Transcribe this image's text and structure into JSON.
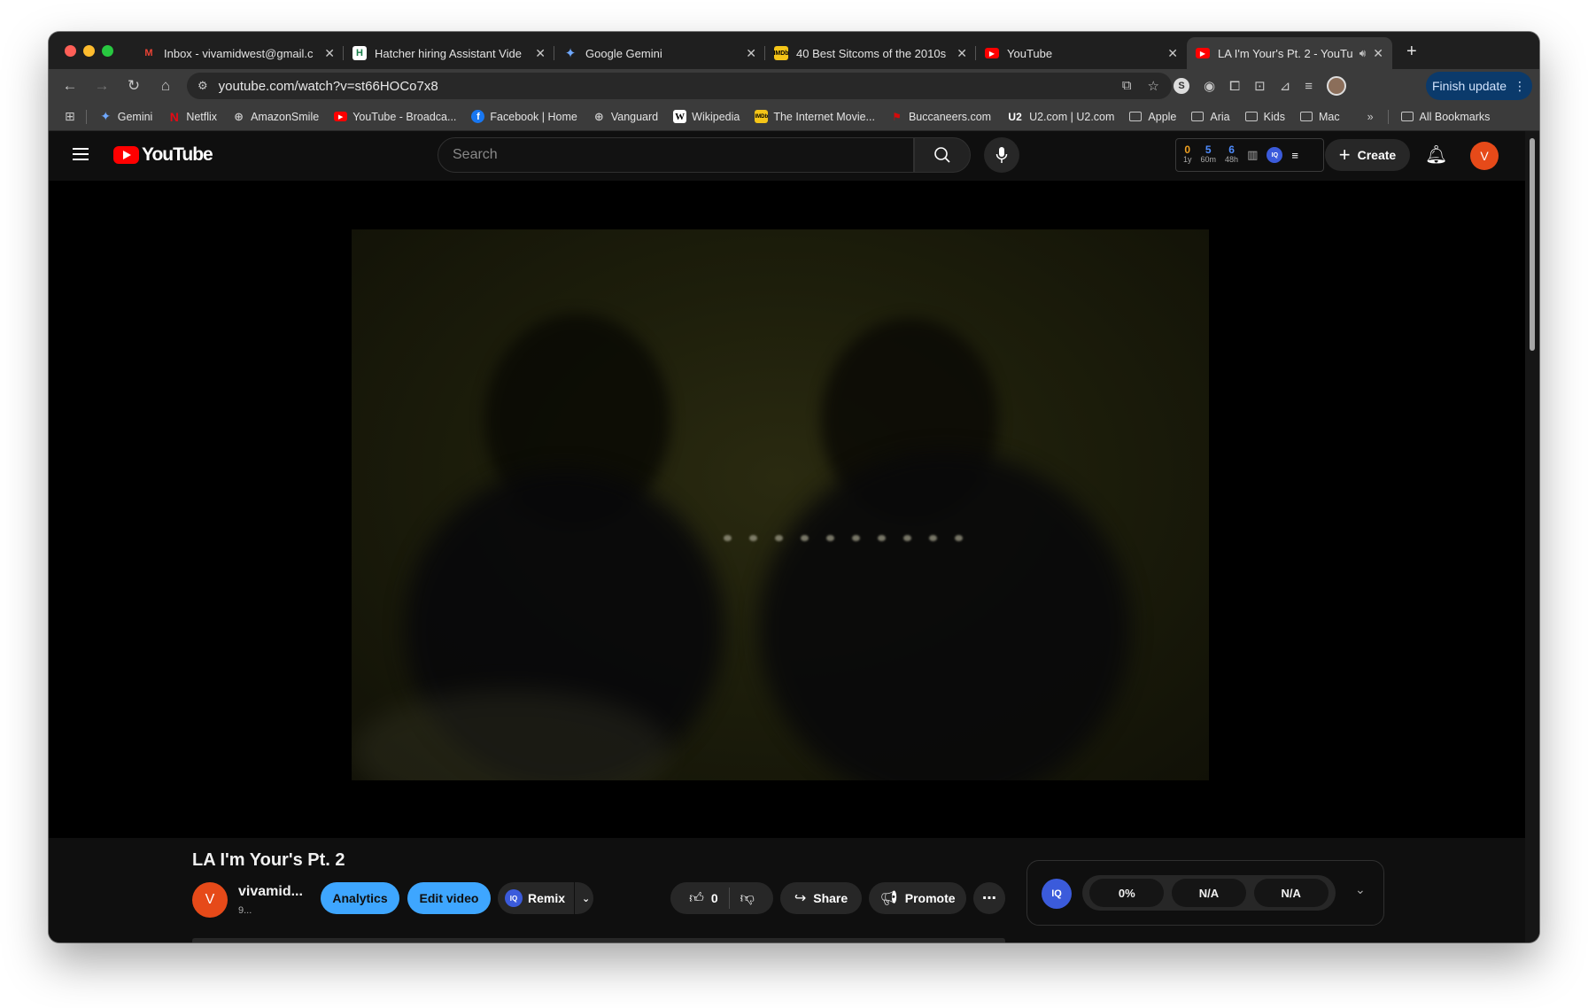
{
  "tabs": [
    {
      "label": "Inbox - vivamidwest@gmail.c",
      "icon": "gmail-icon",
      "active": false
    },
    {
      "label": "Hatcher hiring Assistant Vide",
      "icon": "hatcher-icon",
      "active": false
    },
    {
      "label": "Google Gemini",
      "icon": "gemini-icon",
      "active": false
    },
    {
      "label": "40 Best Sitcoms of the 2010s",
      "icon": "imdb-icon",
      "active": false
    },
    {
      "label": "YouTube",
      "icon": "youtube-icon",
      "active": false
    },
    {
      "label": "LA I'm Your's Pt. 2 - YouTu",
      "icon": "youtube-icon",
      "active": true
    }
  ],
  "toolbar": {
    "url": "youtube.com/watch?v=st66HOCo7x8",
    "finish_update": "Finish update"
  },
  "bookmarks": [
    {
      "label": "Gemini",
      "icon": "gemini-icon"
    },
    {
      "label": "Netflix",
      "icon": "netflix-icon"
    },
    {
      "label": "AmazonSmile",
      "icon": "globe-icon"
    },
    {
      "label": "YouTube - Broadca...",
      "icon": "youtube-icon"
    },
    {
      "label": "Facebook | Home",
      "icon": "facebook-icon"
    },
    {
      "label": "Vanguard",
      "icon": "globe-icon"
    },
    {
      "label": "Wikipedia",
      "icon": "wikipedia-icon"
    },
    {
      "label": "The Internet Movie...",
      "icon": "imdb-icon"
    },
    {
      "label": "Buccaneers.com",
      "icon": "buccaneers-icon"
    },
    {
      "label": "U2.com | U2.com",
      "icon": "u2-icon"
    },
    {
      "label": "Apple",
      "icon": "folder-icon"
    },
    {
      "label": "Aria",
      "icon": "folder-icon"
    },
    {
      "label": "Kids",
      "icon": "folder-icon"
    },
    {
      "label": "Mac",
      "icon": "folder-icon"
    }
  ],
  "all_bookmarks": "All Bookmarks",
  "yt": {
    "logo_text": "YouTube",
    "search_placeholder": "Search",
    "stats": [
      {
        "value": "0",
        "label": "1y",
        "color": "#f0a020"
      },
      {
        "value": "5",
        "label": "60m",
        "color": "#4e8cff"
      },
      {
        "value": "6",
        "label": "48h",
        "color": "#4e8cff"
      }
    ],
    "iq_label": "IQ",
    "create_label": "Create",
    "avatar_letter": "V"
  },
  "video": {
    "title": "LA I'm Your's Pt. 2",
    "channel_name": "vivamid...",
    "channel_subs": "9...",
    "channel_avatar_letter": "V",
    "analytics_label": "Analytics",
    "edit_label": "Edit video",
    "remix_label": "Remix",
    "like_count": "0",
    "share_label": "Share",
    "promote_label": "Promote"
  },
  "iq_panel": {
    "logo": "IQ",
    "metrics": [
      "0%",
      "N/A",
      "N/A"
    ]
  },
  "colors": {
    "accent_blue": "#3ea6ff",
    "youtube_red": "#ff0000",
    "avatar_orange": "#e64a19"
  }
}
